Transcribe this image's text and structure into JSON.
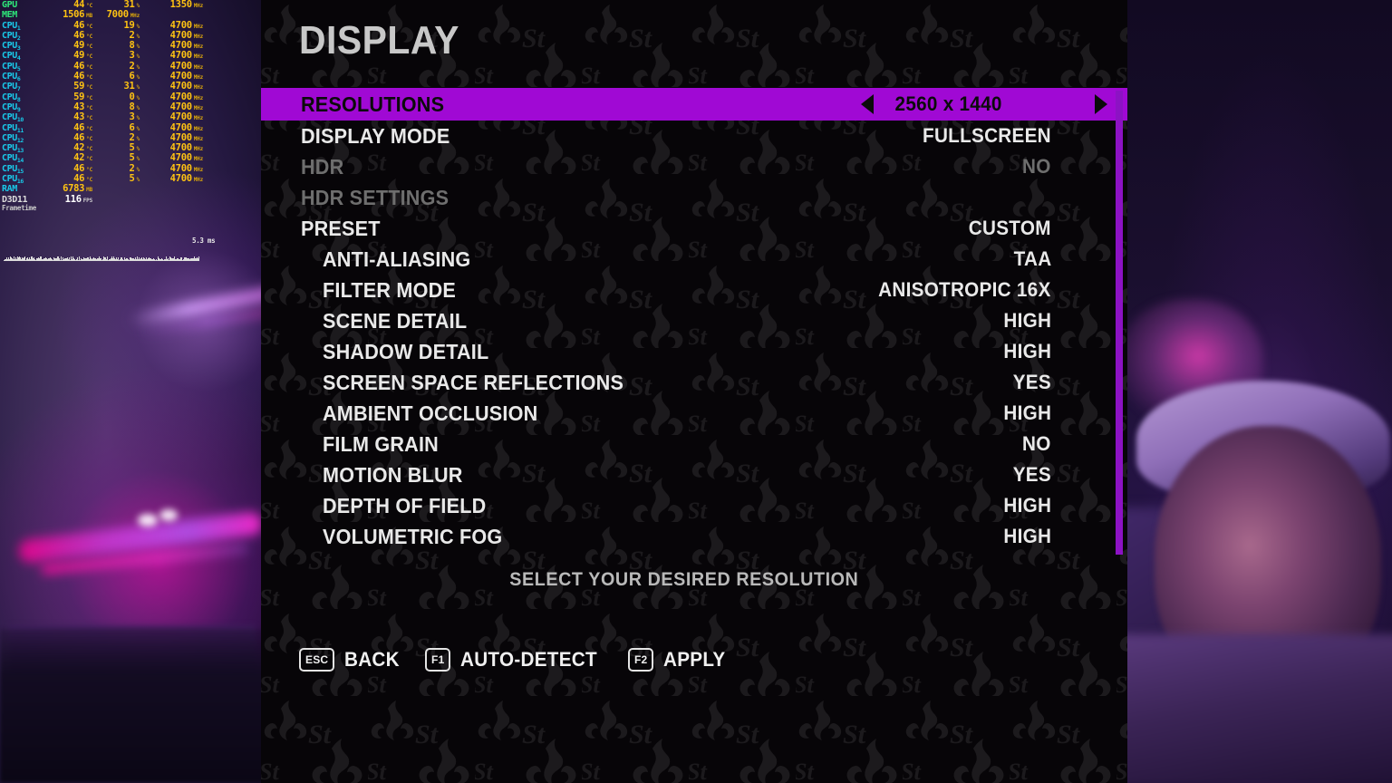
{
  "osd": {
    "rows": [
      {
        "label": "GPU",
        "label_sub": "",
        "color": "grn",
        "f1": "44",
        "u1": "°C",
        "f2": "31",
        "u2": "%",
        "f3": "1350",
        "u3": "MHz"
      },
      {
        "label": "MEM",
        "label_sub": "",
        "color": "grn",
        "f1": "1506",
        "u1": "MB",
        "f2": "7000",
        "u2": "MHz",
        "f3": "",
        "u3": ""
      },
      {
        "label": "CPU",
        "label_sub": "1",
        "color": "cyn",
        "f1": "46",
        "u1": "°C",
        "f2": "19",
        "u2": "%",
        "f3": "4700",
        "u3": "MHz"
      },
      {
        "label": "CPU",
        "label_sub": "2",
        "color": "cyn",
        "f1": "46",
        "u1": "°C",
        "f2": "2",
        "u2": "%",
        "f3": "4700",
        "u3": "MHz"
      },
      {
        "label": "CPU",
        "label_sub": "3",
        "color": "cyn",
        "f1": "49",
        "u1": "°C",
        "f2": "8",
        "u2": "%",
        "f3": "4700",
        "u3": "MHz"
      },
      {
        "label": "CPU",
        "label_sub": "4",
        "color": "cyn",
        "f1": "49",
        "u1": "°C",
        "f2": "3",
        "u2": "%",
        "f3": "4700",
        "u3": "MHz"
      },
      {
        "label": "CPU",
        "label_sub": "5",
        "color": "cyn",
        "f1": "46",
        "u1": "°C",
        "f2": "2",
        "u2": "%",
        "f3": "4700",
        "u3": "MHz"
      },
      {
        "label": "CPU",
        "label_sub": "6",
        "color": "cyn",
        "f1": "46",
        "u1": "°C",
        "f2": "6",
        "u2": "%",
        "f3": "4700",
        "u3": "MHz"
      },
      {
        "label": "CPU",
        "label_sub": "7",
        "color": "cyn",
        "f1": "59",
        "u1": "°C",
        "f2": "31",
        "u2": "%",
        "f3": "4700",
        "u3": "MHz"
      },
      {
        "label": "CPU",
        "label_sub": "8",
        "color": "cyn",
        "f1": "59",
        "u1": "°C",
        "f2": "0",
        "u2": "%",
        "f3": "4700",
        "u3": "MHz"
      },
      {
        "label": "CPU",
        "label_sub": "9",
        "color": "cyn",
        "f1": "43",
        "u1": "°C",
        "f2": "8",
        "u2": "%",
        "f3": "4700",
        "u3": "MHz"
      },
      {
        "label": "CPU",
        "label_sub": "10",
        "color": "cyn",
        "f1": "43",
        "u1": "°C",
        "f2": "3",
        "u2": "%",
        "f3": "4700",
        "u3": "MHz"
      },
      {
        "label": "CPU",
        "label_sub": "11",
        "color": "cyn",
        "f1": "46",
        "u1": "°C",
        "f2": "6",
        "u2": "%",
        "f3": "4700",
        "u3": "MHz"
      },
      {
        "label": "CPU",
        "label_sub": "12",
        "color": "cyn",
        "f1": "46",
        "u1": "°C",
        "f2": "2",
        "u2": "%",
        "f3": "4700",
        "u3": "MHz"
      },
      {
        "label": "CPU",
        "label_sub": "13",
        "color": "cyn",
        "f1": "42",
        "u1": "°C",
        "f2": "5",
        "u2": "%",
        "f3": "4700",
        "u3": "MHz"
      },
      {
        "label": "CPU",
        "label_sub": "14",
        "color": "cyn",
        "f1": "42",
        "u1": "°C",
        "f2": "5",
        "u2": "%",
        "f3": "4700",
        "u3": "MHz"
      },
      {
        "label": "CPU",
        "label_sub": "15",
        "color": "cyn",
        "f1": "46",
        "u1": "°C",
        "f2": "2",
        "u2": "%",
        "f3": "4700",
        "u3": "MHz"
      },
      {
        "label": "CPU",
        "label_sub": "16",
        "color": "cyn",
        "f1": "46",
        "u1": "°C",
        "f2": "5",
        "u2": "%",
        "f3": "4700",
        "u3": "MHz"
      },
      {
        "label": "RAM",
        "label_sub": "",
        "color": "cyn",
        "f1": "6783",
        "u1": "MB",
        "f2": "",
        "u2": "",
        "f3": "",
        "u3": ""
      },
      {
        "label": "D3D11",
        "label_sub": "",
        "color": "wht",
        "f1": "116",
        "u1": "FPS",
        "f2": "",
        "u2": "",
        "f3": "",
        "u3": "",
        "white_value": true
      }
    ],
    "frametime_label": "Frametime",
    "frametime_value": "5.3 ms"
  },
  "menu": {
    "title": "DISPLAY",
    "accent_color": "#a009d4",
    "scroll_accent_color": "#8c12c4",
    "hint": "SELECT YOUR DESIRED RESOLUTION",
    "items": [
      {
        "label": "RESOLUTIONS",
        "value": "2560 x 1440",
        "selected": true,
        "disabled": false,
        "sub": false,
        "arrows": true
      },
      {
        "label": "DISPLAY MODE",
        "value": "FULLSCREEN",
        "selected": false,
        "disabled": false,
        "sub": false,
        "arrows": false
      },
      {
        "label": "HDR",
        "value": "NO",
        "selected": false,
        "disabled": true,
        "sub": false,
        "arrows": false
      },
      {
        "label": "HDR SETTINGS",
        "value": "",
        "selected": false,
        "disabled": true,
        "sub": false,
        "arrows": false
      },
      {
        "label": "PRESET",
        "value": "CUSTOM",
        "selected": false,
        "disabled": false,
        "sub": false,
        "arrows": false
      },
      {
        "label": "ANTI-ALIASING",
        "value": "TAA",
        "selected": false,
        "disabled": false,
        "sub": true,
        "arrows": false
      },
      {
        "label": "FILTER MODE",
        "value": "ANISOTROPIC 16X",
        "selected": false,
        "disabled": false,
        "sub": true,
        "arrows": false
      },
      {
        "label": "SCENE DETAIL",
        "value": "HIGH",
        "selected": false,
        "disabled": false,
        "sub": true,
        "arrows": false
      },
      {
        "label": "SHADOW DETAIL",
        "value": "HIGH",
        "selected": false,
        "disabled": false,
        "sub": true,
        "arrows": false
      },
      {
        "label": "SCREEN SPACE REFLECTIONS",
        "value": "YES",
        "selected": false,
        "disabled": false,
        "sub": true,
        "arrows": false
      },
      {
        "label": "AMBIENT OCCLUSION",
        "value": "HIGH",
        "selected": false,
        "disabled": false,
        "sub": true,
        "arrows": false
      },
      {
        "label": "FILM GRAIN",
        "value": "NO",
        "selected": false,
        "disabled": false,
        "sub": true,
        "arrows": false
      },
      {
        "label": "MOTION BLUR",
        "value": "YES",
        "selected": false,
        "disabled": false,
        "sub": true,
        "arrows": false
      },
      {
        "label": "DEPTH OF FIELD",
        "value": "HIGH",
        "selected": false,
        "disabled": false,
        "sub": true,
        "arrows": false
      },
      {
        "label": "VOLUMETRIC FOG",
        "value": "HIGH",
        "selected": false,
        "disabled": false,
        "sub": true,
        "arrows": false
      }
    ],
    "prompts": [
      {
        "key": "ESC",
        "label": "BACK"
      },
      {
        "key": "F1",
        "label": "AUTO-DETECT"
      },
      {
        "key": "F2",
        "label": "APPLY"
      }
    ]
  }
}
